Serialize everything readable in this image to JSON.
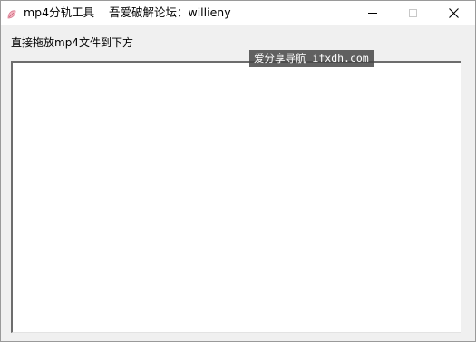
{
  "window": {
    "app_title": "mp4分轨工具",
    "subtitle": "吾爱破解论坛：willieny",
    "icon": "app-leaf-icon",
    "controls": {
      "minimize": "minimize-icon",
      "maximize": "maximize-icon",
      "close": "close-icon"
    }
  },
  "main": {
    "instruction": "直接拖放mp4文件到下方",
    "drop_area": ""
  },
  "overlay": {
    "watermark": "爱分享导航 ifxdh.com"
  },
  "colors": {
    "titlebar_bg": "#ffffff",
    "window_bg": "#f0f0f0",
    "drop_area_bg": "#ffffff",
    "watermark_bg": "#464646"
  }
}
